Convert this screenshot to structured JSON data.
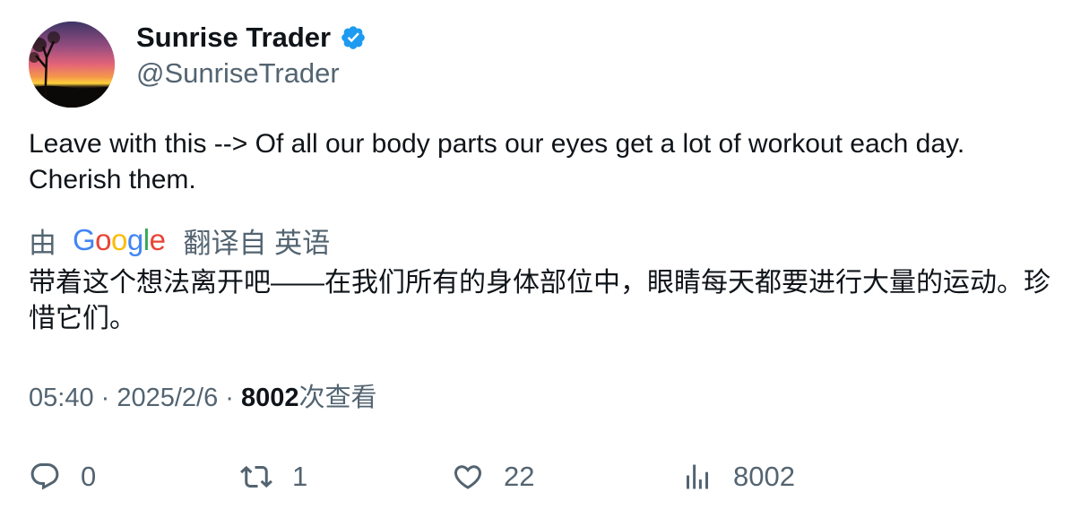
{
  "author": {
    "display_name": "Sunrise Trader",
    "handle": "@SunriseTrader",
    "verified_icon": "verified-badge-icon",
    "avatar": "sunset-photo"
  },
  "tweet": {
    "text": "Leave with this --> Of all our body parts our eyes get a lot of workout each day.\nCherish them."
  },
  "translation": {
    "by_label": "由",
    "provider": "Google",
    "from_label": "翻译自 英语",
    "text": "带着这个想法离开吧——在我们所有的身体部位中，眼睛每天都要进行大量的运动。珍惜它们。"
  },
  "meta": {
    "time": "05:40",
    "separator1": " · ",
    "date": "2025/2/6",
    "separator2": " · ",
    "views_count": "8002",
    "views_label": "次查看"
  },
  "actions": {
    "reply": {
      "icon": "reply-icon",
      "count": "0"
    },
    "retweet": {
      "icon": "retweet-icon",
      "count": "1"
    },
    "like": {
      "icon": "heart-icon",
      "count": "22"
    },
    "views": {
      "icon": "analytics-icon",
      "count": "8002"
    }
  },
  "colors": {
    "verified": "#1d9bf0",
    "secondary_text": "#536471",
    "primary_text": "#0f1419"
  }
}
